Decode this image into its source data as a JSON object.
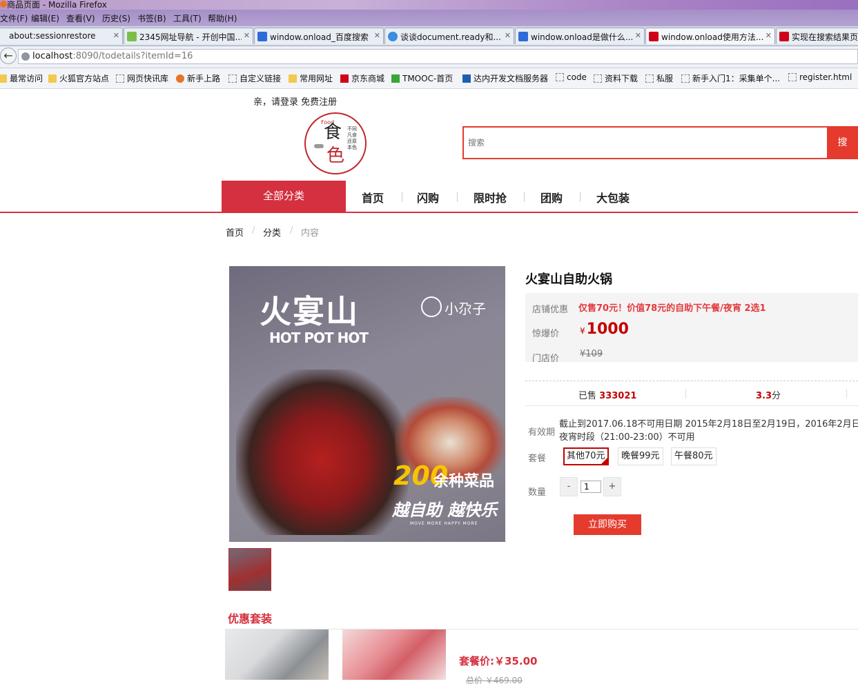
{
  "browser": {
    "window_title": "商品页面 - Mozilla Firefox",
    "menu": [
      "文件(F)",
      "编辑(E)",
      "查看(V)",
      "历史(S)",
      "书签(B)",
      "工具(T)",
      "帮助(H)"
    ],
    "tabs": [
      {
        "label": "about:sessionrestore",
        "icon": "document-icon"
      },
      {
        "label": "2345网址导航 - 开创中国...",
        "icon": "site-icon"
      },
      {
        "label": "window.onload_百度搜索",
        "icon": "baidu-paw-icon"
      },
      {
        "label": "谈谈document.ready和...",
        "icon": "site-icon"
      },
      {
        "label": "window.onload是做什么...",
        "icon": "baidu-paw-icon"
      },
      {
        "label": "window.onload使用方法...",
        "icon": "csdn-icon"
      },
      {
        "label": "实现在搜索结果页",
        "icon": "csdn-icon"
      }
    ],
    "url_host": "localhost",
    "url_rest": ":8090/todetails?itemId=16",
    "bookmarks": [
      {
        "label": "最常访问",
        "icon": "folder"
      },
      {
        "label": "火狐官方站点",
        "icon": "folder"
      },
      {
        "label": "网页快讯库",
        "icon": "dash"
      },
      {
        "label": "新手上路",
        "icon": "fox"
      },
      {
        "label": "自定义链接",
        "icon": "dash"
      },
      {
        "label": "常用网址",
        "icon": "folder"
      },
      {
        "label": "京东商城",
        "icon": "jd"
      },
      {
        "label": "TMOOC-首页",
        "icon": "tm"
      },
      {
        "label": "达内开发文档服务器",
        "icon": "tn"
      },
      {
        "label": "code",
        "icon": "dash"
      },
      {
        "label": "资料下载",
        "icon": "dash"
      },
      {
        "label": "私服",
        "icon": "dash"
      },
      {
        "label": "新手入门1：采集单个...",
        "icon": "dash"
      },
      {
        "label": "register.html",
        "icon": "dash"
      }
    ]
  },
  "header": {
    "login_text": "亲，请登录",
    "register_text": "免费注册",
    "logo": {
      "char_top": "食",
      "char_bottom": "色",
      "small": "Food",
      "vertical": "不同凡食 还原本色"
    },
    "search_placeholder": "搜索",
    "search_button": "搜"
  },
  "nav": {
    "all_categories": "全部分类",
    "items": [
      "首页",
      "闪购",
      "限时抢",
      "团购",
      "大包装"
    ]
  },
  "breadcrumb": [
    "首页",
    "分类",
    "内容"
  ],
  "product": {
    "image": {
      "brand": "火宴山",
      "brand_sub": "HOT POT HOT",
      "partner": "小尕子",
      "count": "200",
      "count_text": "余种菜品",
      "slogan": "越自助 越快乐",
      "slogan_small": "MOVE MORE HAPPY MORE"
    },
    "title": "火宴山自助火锅",
    "promo_label": "店铺优惠",
    "promo_text": "仅售70元！价值78元的自助下午餐/夜宵 2选1",
    "price_label": "惊爆价",
    "currency": "¥",
    "price": "1000",
    "orig_label": "门店价",
    "orig_price": "¥109",
    "sold_label": "已售",
    "sold": "333021",
    "rating": "3.3",
    "rating_unit": "分",
    "validity_label": "有效期",
    "validity_text": "截止到2017.06.18不可用日期 2015年2月18日至2月19日，2016年2月日夜宵时段（21:00-23:00）不可用",
    "package_label": "套餐",
    "packages": [
      "其他70元",
      "晚餐99元",
      "午餐80元"
    ],
    "qty_label": "数量",
    "qty_minus": "-",
    "qty_plus": "+",
    "quantity": "1",
    "buy_label": "立即购买"
  },
  "combo": {
    "title": "优惠套装",
    "price_text": "套餐价:￥35.00",
    "old_price": "总价 ￥469.00"
  },
  "colors": {
    "brand_red": "#d5303f",
    "search_red": "#e43b2e",
    "price_red": "#c40000"
  }
}
